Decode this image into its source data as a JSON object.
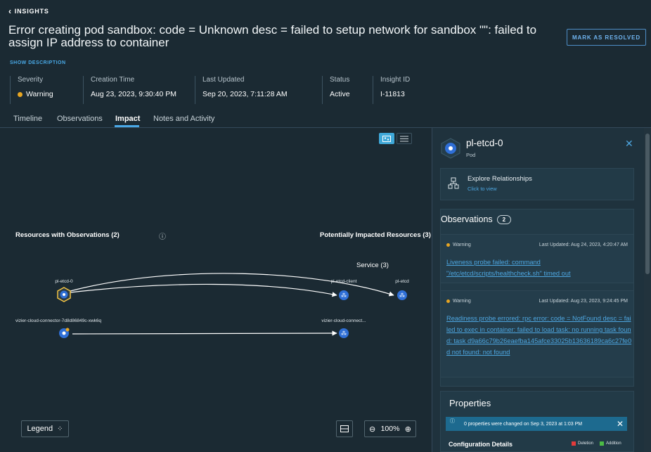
{
  "header": {
    "back_label": "INSIGHTS",
    "title": "Error creating pod sandbox: code = Unknown desc = failed to setup network for sandbox \"\": failed to assign IP address to container",
    "resolve_label": "MARK AS RESOLVED",
    "show_description": "SHOW DESCRIPTION"
  },
  "meta": [
    {
      "label": "Severity",
      "value": "Warning"
    },
    {
      "label": "Creation Time",
      "value": "Aug 23, 2023, 9:30:40 PM"
    },
    {
      "label": "Last Updated",
      "value": "Sep 20, 2023, 7:11:28 AM"
    },
    {
      "label": "Status",
      "value": "Active"
    },
    {
      "label": "Insight ID",
      "value": "I-11813"
    }
  ],
  "tabs": [
    "Timeline",
    "Observations",
    "Impact",
    "Notes and Activity"
  ],
  "active_tab": "Impact",
  "graph": {
    "left_title": "Resources with Observations (2)",
    "right_title": "Potentially Impacted Resources (3)",
    "service_group": "Service (3)",
    "nodes": {
      "pod1": "pl-etcd-0",
      "pod2": "vizier-cloud-connector-7d8d86849c-xwk6q",
      "svc1": "pl-etcd-client",
      "svc2": "pl-etcd",
      "svc3": "vizier-cloud-connect..."
    },
    "legend_label": "Legend",
    "zoom": "100%",
    "colors": {
      "node": "#2f6fd6",
      "accent": "#3fa8d8"
    }
  },
  "panel": {
    "name": "pl-etcd-0",
    "type": "Pod",
    "explore_title": "Explore Relationships",
    "explore_sub": "Click to view",
    "observations_title": "Observations",
    "observations_count": "2",
    "observations": [
      {
        "severity": "Warning",
        "updated": "Last Updated: Aug 24, 2023, 4:20:47 AM",
        "text": "Liveness probe failed: command \"/etc/etcd/scripts/healthcheck.sh\" timed out"
      },
      {
        "severity": "Warning",
        "updated": "Last Updated: Aug 23, 2023, 9:24:45 PM",
        "text": "Readiness probe errored: rpc error: code = NotFound desc = failed to exec in container: failed to load task: no running task found: task d9a66c79b26eaefba145afce33025b13636189ca6c27fe0d not found: not found"
      }
    ],
    "properties_title": "Properties",
    "banner": "0 properties were changed on Sep 3, 2023 at 1:03 PM",
    "config_title": "Configuration Details",
    "legend_deletion": "Deletion",
    "legend_addition": "Addition",
    "colors": {
      "warning": "#e8a622",
      "deletion": "#e23b3b",
      "addition": "#4cbb45",
      "link": "#4da6e0"
    }
  }
}
